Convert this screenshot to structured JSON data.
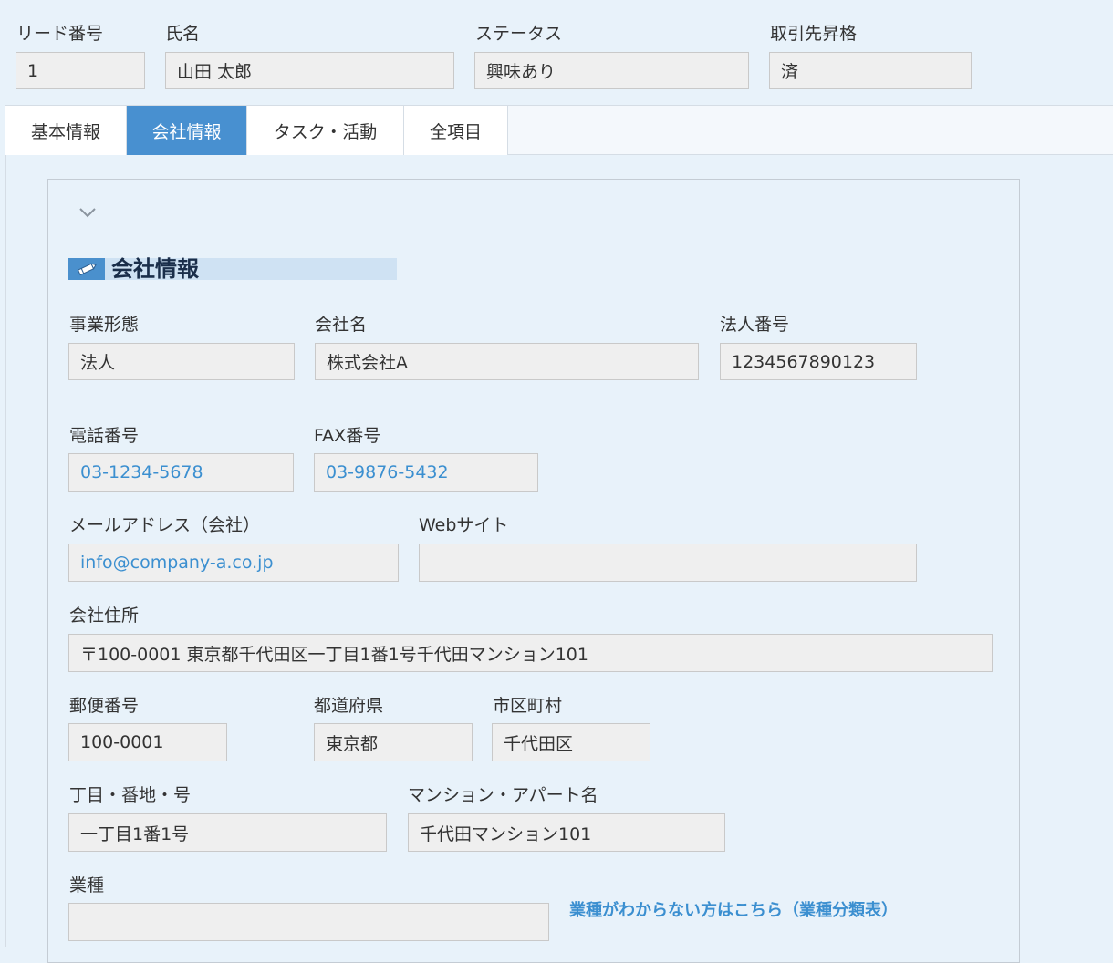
{
  "header": {
    "lead_no_label": "リード番号",
    "lead_no": "1",
    "name_label": "氏名",
    "name": "山田 太郎",
    "status_label": "ステータス",
    "status": "興味あり",
    "promo_label": "取引先昇格",
    "promo": "済"
  },
  "tabs": [
    "基本情報",
    "会社情報",
    "タスク・活動",
    "全項目"
  ],
  "section": {
    "title": "会社情報"
  },
  "fields": {
    "biz_type_label": "事業形態",
    "biz_type": "法人",
    "company_label": "会社名",
    "company": "株式会社A",
    "corp_no_label": "法人番号",
    "corp_no": "1234567890123",
    "tel_label": "電話番号",
    "tel": "03-1234-5678",
    "fax_label": "FAX番号",
    "fax": "03-9876-5432",
    "email_label": "メールアドレス（会社）",
    "email": "info@company-a.co.jp",
    "web_label": "Webサイト",
    "web": "",
    "address_label": "会社住所",
    "address": "〒100-0001 東京都千代田区一丁目1番1号千代田マンション101",
    "zip_label": "郵便番号",
    "zip": "100-0001",
    "pref_label": "都道府県",
    "pref": "東京都",
    "city_label": "市区町村",
    "city": "千代田区",
    "street_label": "丁目・番地・号",
    "street": "一丁目1番1号",
    "building_label": "マンション・アパート名",
    "building": "千代田マンション101",
    "industry_label": "業種",
    "industry": ""
  },
  "help_link": "業種がわからない方はこちら（業種分類表）",
  "colors": {
    "accent": "#4890d0",
    "link": "#3b8fd0",
    "background": "#e8f2fa",
    "field": "#efefef"
  },
  "icons": {
    "collapse": "chevron-down-icon",
    "section": "pencil-icon"
  }
}
